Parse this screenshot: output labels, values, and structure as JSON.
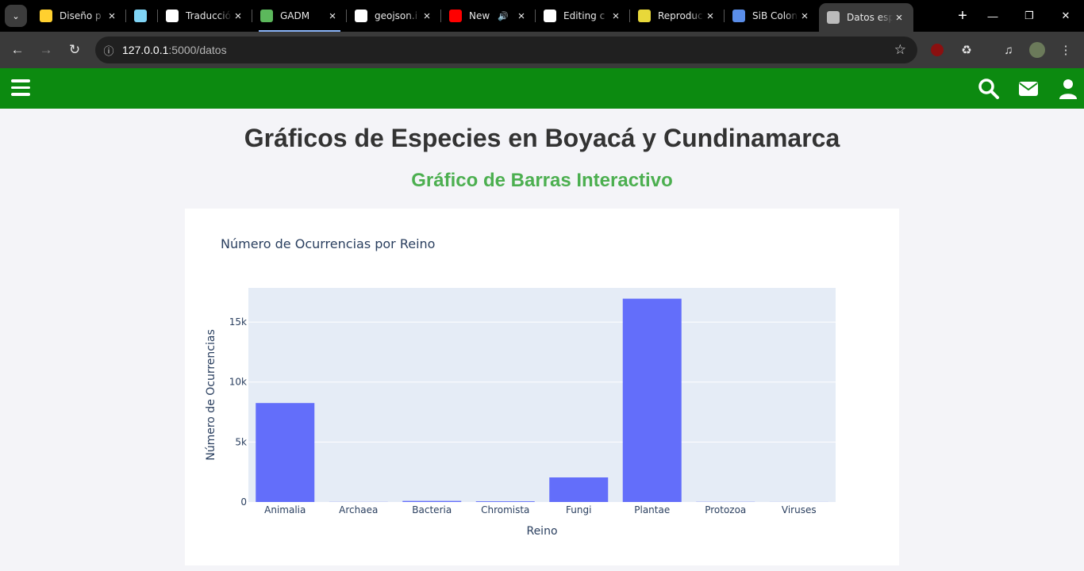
{
  "browser": {
    "tabs": [
      {
        "title": "Diseño p",
        "favicon": "miro-icon",
        "color": "#ffd02f"
      },
      {
        "title": "",
        "favicon": "generic-icon",
        "color": "#7fd4f5"
      },
      {
        "title": "Traducció",
        "favicon": "openai-icon",
        "color": "#ffffff"
      },
      {
        "title": "GADM",
        "favicon": "gadm-icon",
        "color": "#5cb85c"
      },
      {
        "title": "geojson.i",
        "favicon": "geojson-icon",
        "color": "#ffffff"
      },
      {
        "title": "New",
        "favicon": "youtube-icon",
        "color": "#ff0000"
      },
      {
        "title": "Editing c",
        "favicon": "github-icon",
        "color": "#ffffff"
      },
      {
        "title": "Reproduc",
        "favicon": "shield-icon",
        "color": "#e8d83a"
      },
      {
        "title": "SiB Colon",
        "favicon": "sib-icon",
        "color": "#5a8de8"
      },
      {
        "title": "Datos esp",
        "favicon": "globe-icon",
        "color": "#bbbbbb"
      }
    ],
    "url_host": "127.0.0.1",
    "url_path": ":5000/datos"
  },
  "page": {
    "title": "Gráficos de Especies en Boyacá y Cundinamarca",
    "section_title": "Gráfico de Barras Interactivo",
    "brand_color": "#0c8a10"
  },
  "chart_data": {
    "type": "bar",
    "title": "Número de Ocurrencias por Reino",
    "xlabel": "Reino",
    "ylabel": "Número de Ocurrencias",
    "categories": [
      "Animalia",
      "Archaea",
      "Bacteria",
      "Chromista",
      "Fungi",
      "Plantae",
      "Protozoa",
      "Viruses"
    ],
    "values": [
      8250,
      10,
      90,
      60,
      2050,
      16950,
      15,
      5
    ],
    "ylim": [
      0,
      17850
    ],
    "yticks": [
      0,
      5000,
      10000,
      15000
    ],
    "ytick_labels": [
      "0",
      "5k",
      "10k",
      "15k"
    ],
    "grid": true,
    "bar_color": "#636efa",
    "plot_bg": "#e5ecf6"
  }
}
